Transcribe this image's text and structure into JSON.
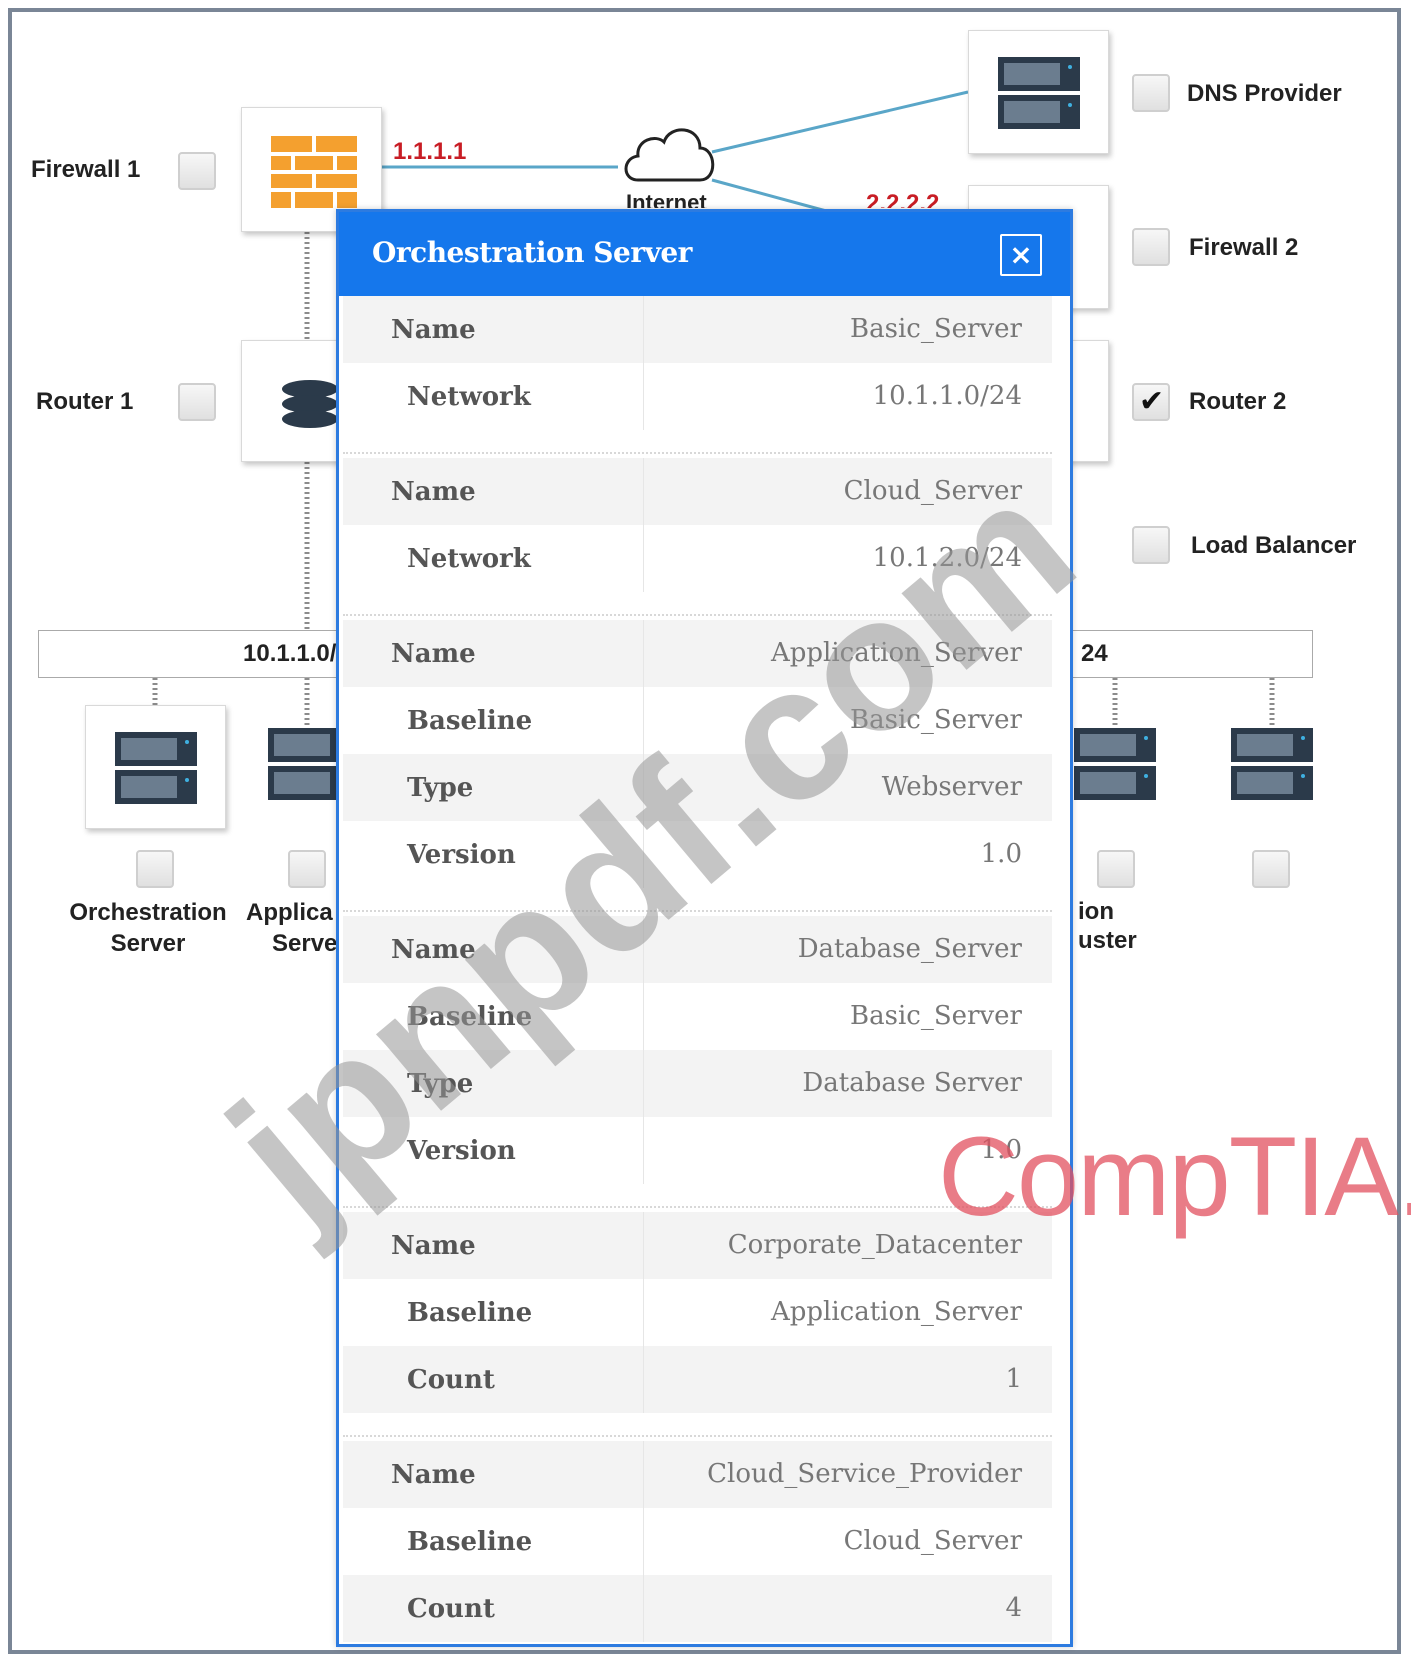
{
  "diagram": {
    "nodes": {
      "firewall1": {
        "label": "Firewall 1",
        "checked": false
      },
      "router1": {
        "label": "Router 1",
        "checked": false
      },
      "dns_provider": {
        "label": "DNS Provider",
        "checked": false
      },
      "firewall2": {
        "label": "Firewall 2",
        "checked": false
      },
      "router2": {
        "label": "Router 2",
        "checked": true
      },
      "load_balancer": {
        "label": "Load Balancer",
        "checked": false
      },
      "orchestration_server": {
        "label_line1": "Orchestration",
        "label_line2": "Server",
        "checked": false
      },
      "application_server": {
        "label_line1": "Applica",
        "label_line2": "Serve",
        "checked": false
      },
      "right_server_a": {
        "label_line1": "ion",
        "label_line2": "uster",
        "checked": false
      },
      "right_server_b": {
        "checked": false
      }
    },
    "internet_label": "Internet",
    "ip_firewall1": "1.1.1.1",
    "ip_firewall2": "2.2.2.2",
    "subnet_left": "10.1.1.0/",
    "subnet_right": "24"
  },
  "modal": {
    "title": "Orchestration Server",
    "close_symbol": "×",
    "groups": [
      {
        "rows": [
          {
            "key": "Name",
            "value": "Basic_Server"
          },
          {
            "key": "Network",
            "value": "10.1.1.0/24"
          }
        ]
      },
      {
        "rows": [
          {
            "key": "Name",
            "value": "Cloud_Server"
          },
          {
            "key": "Network",
            "value": "10.1.2.0/24"
          }
        ]
      },
      {
        "rows": [
          {
            "key": "Name",
            "value": "Application_Server"
          },
          {
            "key": "Baseline",
            "value": "Basic_Server"
          },
          {
            "key": "Type",
            "value": "Webserver"
          },
          {
            "key": "Version",
            "value": "1.0"
          }
        ]
      },
      {
        "rows": [
          {
            "key": "Name",
            "value": "Database_Server"
          },
          {
            "key": "Baseline",
            "value": "Basic_Server"
          },
          {
            "key": "Type",
            "value": "Database Server"
          },
          {
            "key": "Version",
            "value": "1.0"
          }
        ]
      },
      {
        "rows": [
          {
            "key": "Name",
            "value": "Corporate_Datacenter"
          },
          {
            "key": "Baseline",
            "value": "Application_Server"
          },
          {
            "key": "Count",
            "value": "1"
          }
        ]
      },
      {
        "rows": [
          {
            "key": "Name",
            "value": "Cloud_Service_Provider"
          },
          {
            "key": "Baseline",
            "value": "Cloud_Server"
          },
          {
            "key": "Count",
            "value": "4"
          }
        ]
      }
    ]
  },
  "overlay": {
    "watermark": "jpnpdf.com",
    "brand": "CompTIA."
  },
  "colors": {
    "modal_header": "#1577ec",
    "ip_text": "#c81d25",
    "connection_line": "#5aa6c8",
    "brand": "#e2505f"
  }
}
